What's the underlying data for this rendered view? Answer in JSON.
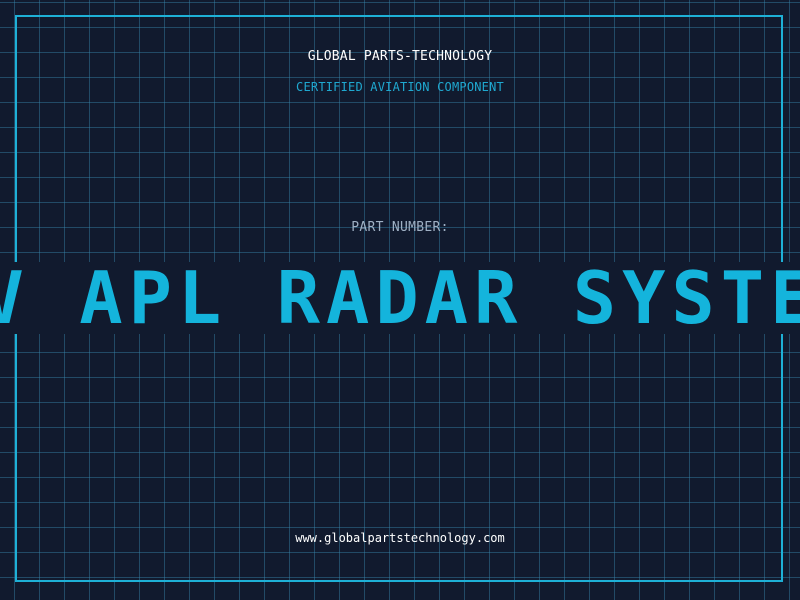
{
  "header": {
    "company": "GLOBAL PARTS-TECHNOLOGY",
    "tagline": "CERTIFIED AVIATION COMPONENT"
  },
  "part": {
    "label": "PART NUMBER:",
    "name": "HV APL RADAR SYSTEM"
  },
  "footer": {
    "website": "www.globalpartstechnology.com"
  },
  "colors": {
    "background": "#111a2e",
    "accent": "#14b4dc",
    "grid": "#2a5a78",
    "frame": "#1eb0d6",
    "label": "#9fb0c4",
    "text": "#ffffff"
  }
}
